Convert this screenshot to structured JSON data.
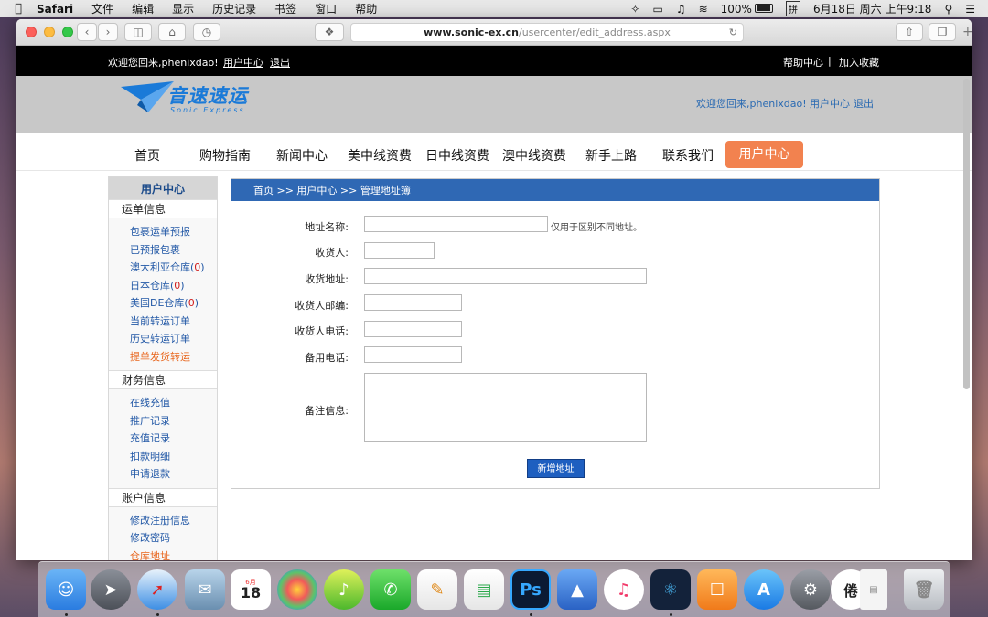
{
  "menubar": {
    "app": "Safari",
    "items": [
      "文件",
      "编辑",
      "显示",
      "历史记录",
      "书签",
      "窗口",
      "帮助"
    ],
    "battery": "100%",
    "input_method": "拼",
    "datetime": "6月18日 周六 上午9:18"
  },
  "browser": {
    "url_host": "www.sonic-ex.cn",
    "url_path": "/usercenter/edit_address.aspx"
  },
  "topstrip": {
    "welcome": "欢迎您回来,phenixdao!",
    "user_center": "用户中心",
    "logout": "退出",
    "help": "帮助中心",
    "separator": "|",
    "favorite": "加入收藏"
  },
  "header": {
    "logo_cn": "音速速运",
    "logo_en": "Sonic Express",
    "welcome": "欢迎您回来,phenixdao!",
    "user_center": "用户中心",
    "logout": "退出"
  },
  "nav": {
    "items": [
      "首页",
      "购物指南",
      "新闻中心",
      "美中线资费",
      "日中线资费",
      "澳中线资费",
      "新手上路",
      "联系我们"
    ],
    "active": "用户中心"
  },
  "sidebar": {
    "title": "用户中心",
    "section1": "运单信息",
    "links1": [
      "包裹运单预报",
      "已预报包裹",
      "澳大利亚仓库",
      "日本仓库",
      "美国DE仓库",
      "当前转运订单",
      "历史转运订单",
      "提单发货转运"
    ],
    "counts": [
      "0",
      "0",
      "0"
    ],
    "section2": "财务信息",
    "links2": [
      "在线充值",
      "推广记录",
      "充值记录",
      "扣款明细",
      "申请退款"
    ],
    "section3": "账户信息",
    "links3": [
      "修改注册信息",
      "修改密码",
      "仓库地址"
    ]
  },
  "main": {
    "breadcrumb": "首页 >> 用户中心 >> 管理地址簿",
    "labels": {
      "name": "地址名称:",
      "receiver": "收货人:",
      "address": "收货地址:",
      "zip": "收货人邮编:",
      "phone": "收货人电话:",
      "alt_phone": "备用电话:",
      "note": "备注信息:"
    },
    "name_hint": "仅用于区别不同地址。",
    "submit": "新增地址"
  },
  "dock": {
    "calendar_month": "6月",
    "calendar_day": "18",
    "ps_label": "Ps"
  }
}
